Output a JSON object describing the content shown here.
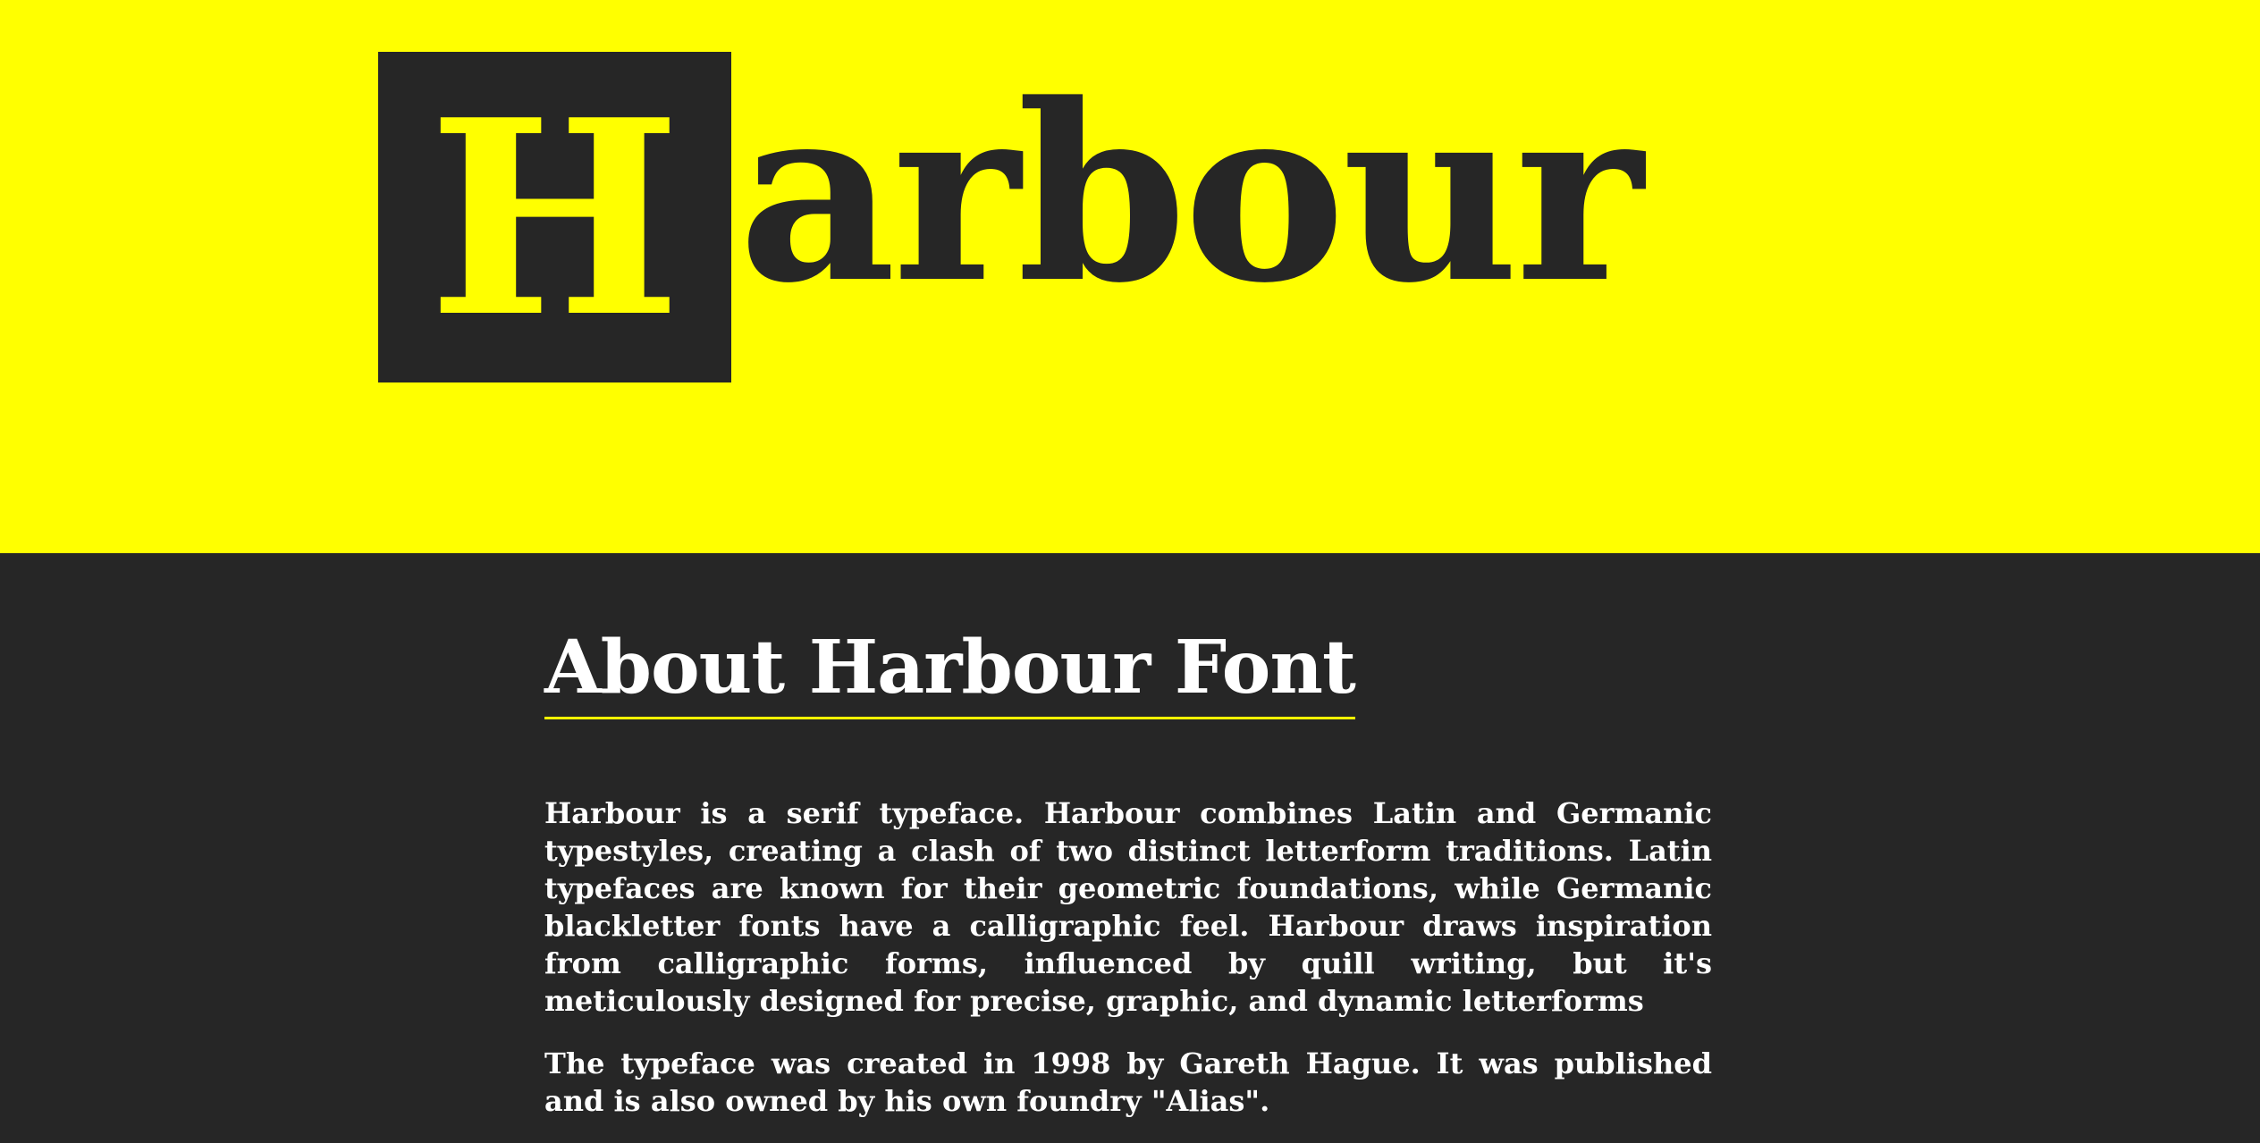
{
  "colors": {
    "accent": "#ffff00",
    "dark": "#262626",
    "text": "#ffffff"
  },
  "logo": {
    "first_letter": "H",
    "rest": "arbour"
  },
  "about": {
    "title": "About Harbour Font",
    "paragraphs": [
      "Harbour is a serif typeface. Harbour combines Latin and Germanic typestyles, creating a clash of two distinct letterform traditions. Latin typefaces are known for their geometric foundations, while Germanic blackletter fonts have a calligraphic feel. Harbour draws inspiration from calligraphic forms, influenced by quill writing, but it's meticulously designed for precise, graphic, and dynamic letterforms",
      "The typeface was created in 1998 by Gareth Hague. It was published and is also owned by his own foundry \"Alias\"."
    ]
  }
}
